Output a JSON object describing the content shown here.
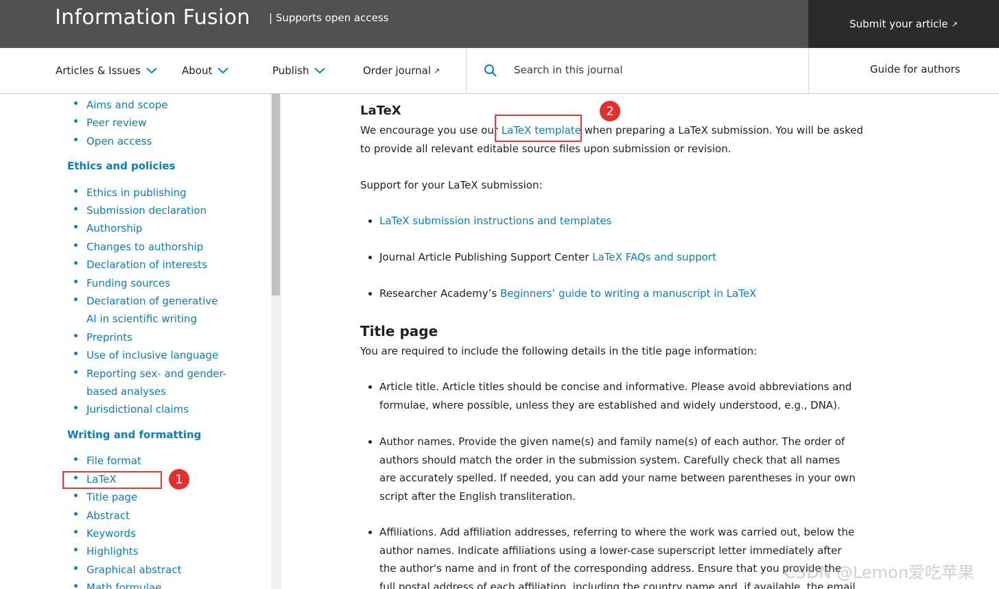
{
  "header": {
    "journal_title": "Information Fusion",
    "tagline": "| Supports open access",
    "submit_label": "Submit your article",
    "submit_arrow": "↗"
  },
  "nav": {
    "items": [
      {
        "label": "Articles & Issues",
        "icon": "chevron-down-icon"
      },
      {
        "label": "About",
        "icon": "chevron-down-icon"
      },
      {
        "label": "Publish",
        "icon": "chevron-down-icon"
      },
      {
        "label": "Order journal",
        "icon": "arrow-up-right-icon",
        "arrow": "↗"
      }
    ],
    "search_placeholder": "Search in this journal",
    "guide_label": "Guide for authors"
  },
  "sidebar": {
    "group0": [
      "Aims and scope",
      "Peer review",
      "Open access"
    ],
    "ethics_heading": "Ethics and policies",
    "ethics_items": [
      "Ethics in publishing",
      "Submission declaration",
      "Authorship",
      "Changes to authorship",
      "Declaration of interests",
      "Funding sources",
      "Declaration of generative",
      "AI in scientific writing",
      "Preprints",
      "Use of inclusive language",
      "Reporting sex- and gender-",
      "based analyses",
      "Jurisdictional claims"
    ],
    "writing_heading": "Writing and formatting",
    "writing_items": [
      "File format",
      "LaTeX",
      "Title page",
      "Abstract",
      "Keywords",
      "Highlights",
      "Graphical abstract",
      "Math formulae"
    ]
  },
  "content": {
    "latex_heading": "LaTeX",
    "latex_p1_before": "We encourage you use our ",
    "latex_p1_link": "LaTeX template",
    "latex_p1_after": " when preparing a LaTeX submission. You will be asked to provide all relevant editable source files upon submission or revision.",
    "support_intro": "Support for your LaTeX submission:",
    "support_link1": "LaTeX submission instructions and templates",
    "support2_prefix": "Journal Article Publishing Support Center ",
    "support2_link": "LaTeX FAQs and support",
    "support3_prefix": "Researcher Academy’s ",
    "support3_link": "Beginners’ guide to writing a manuscript in LaTeX",
    "title_heading": "Title page",
    "title_intro": "You are required to include the following details in the title page information:",
    "title_bullet1": "Article title. Article titles should be concise and informative. Please avoid abbreviations and formulae, where possible, unless they are established and widely understood, e.g., DNA).",
    "title_bullet2": "Author names. Provide the given name(s) and family name(s) of each author. The order of authors should match the order in the submission system. Carefully check that all names are accurately spelled. If needed, you can add your name between parentheses in your own script after the English transliteration.",
    "title_bullet3": "Affiliations. Add affiliation addresses, referring to where the work was carried out, below the author names. Indicate affiliations using a lower-case superscript letter immediately after the author's name and in front of the corresponding address. Ensure that you provide the full postal address of each affiliation, including the country name and, if available, the email address of"
  },
  "annotations": {
    "badge1": "1",
    "badge2": "2",
    "color": "#e23a3a"
  },
  "watermark": "CSDN @Lemon爱吃苹果",
  "colors": {
    "link": "#0c7dbb",
    "topbar": "#505050",
    "submit_bg": "#2b2b2b"
  }
}
